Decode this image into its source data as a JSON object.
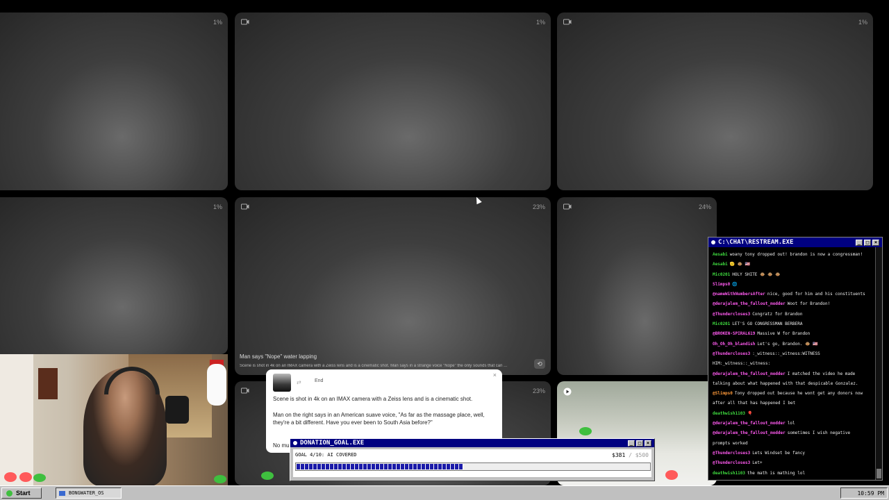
{
  "tiles": [
    {
      "progress": "1%"
    },
    {
      "progress": "1%"
    },
    {
      "progress": "1%"
    },
    {
      "progress": "1%"
    },
    {
      "progress": "23%",
      "caption_title": "Man says \"Nope\" water lapping",
      "caption_sub": "Scene is shot in 4k on an IMAX camera with a Zeiss lens and is a cinematic shot. Man says in a strange voice \"Nope\" the only sounds that can ..."
    },
    {
      "progress": "24%"
    },
    {
      "progress": "23%"
    },
    {
      "progress": ""
    }
  ],
  "prompt_popup": {
    "end_label": "End",
    "swap_glyph": "⇄",
    "close_glyph": "×",
    "line1": "Scene is shot in 4k on an IMAX camera with a Zeiss lens and is a cinematic shot.",
    "line2": "Man on the right says in an American suave voice, \"As far as the massage place, well, they're a bit different. Have you ever been to South Asia before?\"",
    "line3": "No mu"
  },
  "chat": {
    "title": "C:\\CHAT\\RESTREAM.EXE",
    "messages": [
      {
        "user": "Aesabi",
        "text": "woany tony dropped out! brandon is now a congressman!",
        "color": "green"
      },
      {
        "user": "Aesabi",
        "text": "🫡 🐵 🇺🇸",
        "color": "green"
      },
      {
        "user": "Mic0201",
        "text": "HOLY SHITE 🐵 🐵 🐵",
        "color": "green"
      },
      {
        "user": "Slimps0",
        "text": "🌐",
        "color": "pink"
      },
      {
        "user": "@nameWithNumbersAfter",
        "text": "nice, good for him and his constituents",
        "color": "pink"
      },
      {
        "user": "@derajalem_the_fallout_modder",
        "text": "Woot for Brandon!",
        "color": "pink"
      },
      {
        "user": "@Thundercloses3",
        "text": "Congratz for Brandon",
        "color": "pink"
      },
      {
        "user": "Mic0201",
        "text": "LET'S GO CONGRESSMAN BERBERA",
        "color": "green"
      },
      {
        "user": "@BROKEN-SPIRAL619",
        "text": "Massive W for Brandon",
        "color": "pink"
      },
      {
        "user": "Oh_Oh_Oh_blandish",
        "text": "Let's go, Brandon. 🐵 🇺🇸",
        "color": "pink"
      },
      {
        "user": "@Thundercloses3",
        "text": ":_witness::_witness:WITNESS",
        "color": "pink"
      },
      {
        "user": "",
        "text": "HIM:_witness::_witness:",
        "color": "green"
      },
      {
        "user": "@derajalem_the_fallout_modder",
        "text": "I matched the video he made",
        "color": "pink"
      },
      {
        "user": "",
        "text": "talking about what happened with that despicable Gonzalez.",
        "color": "green"
      },
      {
        "user": "@Slimps0",
        "text": "Tony dropped out because he wont get any donors now",
        "color": "orange"
      },
      {
        "user": "",
        "text": "after all that has happened I bet",
        "color": "green"
      },
      {
        "user": "deathwish1103",
        "text": "🎈",
        "color": "green"
      },
      {
        "user": "@derajalem_the_fallout_modder",
        "text": "lol",
        "color": "pink"
      },
      {
        "user": "@derajalem_the_fallout_modder",
        "text": "sometimes I wish negative",
        "color": "pink"
      },
      {
        "user": "",
        "text": "prompts worked",
        "color": "green"
      },
      {
        "user": "@Thundercloses3",
        "text": "Lets Windset be fancy",
        "color": "pink"
      },
      {
        "user": "@Thundercloses3",
        "text": "Let+",
        "color": "pink"
      },
      {
        "user": "deathwish1103",
        "text": "the math is mathing lol",
        "color": "green"
      }
    ]
  },
  "donation": {
    "title": "DONATION_GOAL.EXE",
    "goal_text": "GOAL 4/10: AI COVERED",
    "current": "$381",
    "total": "/ $500",
    "progress": 0.47
  },
  "taskbar": {
    "start_label": "Start",
    "task_label": "BONGWATER_OS",
    "clock": "10:59 PM"
  },
  "colors": {
    "title_bar": "#000080",
    "chrome": "#c0c0c0",
    "chat_user_green": "#3fdc3f",
    "chat_user_pink": "#ff5af0",
    "progress_fill": "#1a1aa8"
  }
}
